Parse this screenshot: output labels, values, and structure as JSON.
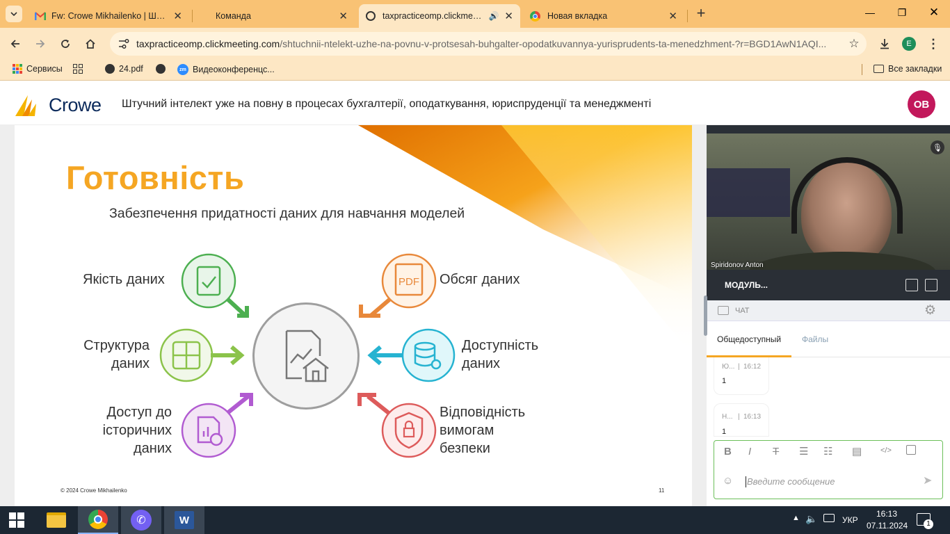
{
  "browser": {
    "tabs": [
      {
        "title": "Fw: Crowe Mikhailenko | Штучн",
        "icon": "gmail-icon",
        "active": false
      },
      {
        "title": "Команда",
        "icon": "blank",
        "active": false
      },
      {
        "title": "taxpracticeomp.clickmeeting",
        "icon": "site-icon",
        "active": true
      },
      {
        "title": "Новая вкладка",
        "icon": "chrome-icon",
        "active": false
      }
    ],
    "url_host": "taxpracticeomp.clickmeeting.com",
    "url_path": "/shtuchnii-ntelekt-uzhe-na-povnu-v-protsesah-buhgalter-opodatkuvannya-yurisprudents-ta-menedzhment-?r=BGD1AwN1AQI...",
    "profile_initial": "E",
    "bookmarks": [
      {
        "label": "Сервисы",
        "icon": "apps-grid-icon"
      },
      {
        "label": "",
        "icon": "grid-icon"
      },
      {
        "label": "24.pdf",
        "icon": "globe-icon"
      },
      {
        "label": "",
        "icon": "globe-icon"
      },
      {
        "label": "Видеоконференцс...",
        "icon": "zoom-icon"
      }
    ],
    "all_bookmarks": "Все закладки"
  },
  "app": {
    "logo_text": "Crowe",
    "title": "Штучний інтелект уже на повну в процесах бухгалтерії, оподаткування, юриспруденції та менеджменті",
    "user_initials": "OB"
  },
  "slide": {
    "heading": "Готовність",
    "subtitle": "Забезпечення придатності даних для навчання моделей",
    "items": {
      "quality": "Якість даних",
      "structure": "Структура даних",
      "access": "Доступ до історичних даних",
      "volume": "Обсяг даних",
      "availability": "Доступність даних",
      "security": "Відповідність вимогам безпеки"
    },
    "footer": "© 2024 Crowe Mikhailenko",
    "page_number": "11"
  },
  "panel": {
    "speaker_name": "Spiridonov Anton",
    "module_label": "МОДУЛЬ...",
    "chat_label": "ЧАТ",
    "tabs": [
      "Общедоступный",
      "Файлы"
    ],
    "messages": [
      {
        "author": "Ю...",
        "time": "16:12",
        "text": "1"
      },
      {
        "author": "Н...",
        "time": "16:13",
        "text": "1"
      }
    ],
    "composer_placeholder": "Введите сообщение"
  },
  "taskbar": {
    "language": "УКР",
    "time": "16:13",
    "date": "07.11.2024",
    "notification_count": "1"
  },
  "colors": {
    "tab_strip": "#f9c274",
    "toolbar": "#fde7c4",
    "heading_gold": "#f5a623",
    "avatar": "#c2185b",
    "green": "#4caf50",
    "orange": "#e8883a",
    "lime": "#8bc34a",
    "cyan": "#26b3d1",
    "purple": "#b15bd1",
    "red": "#dd5b5b"
  }
}
